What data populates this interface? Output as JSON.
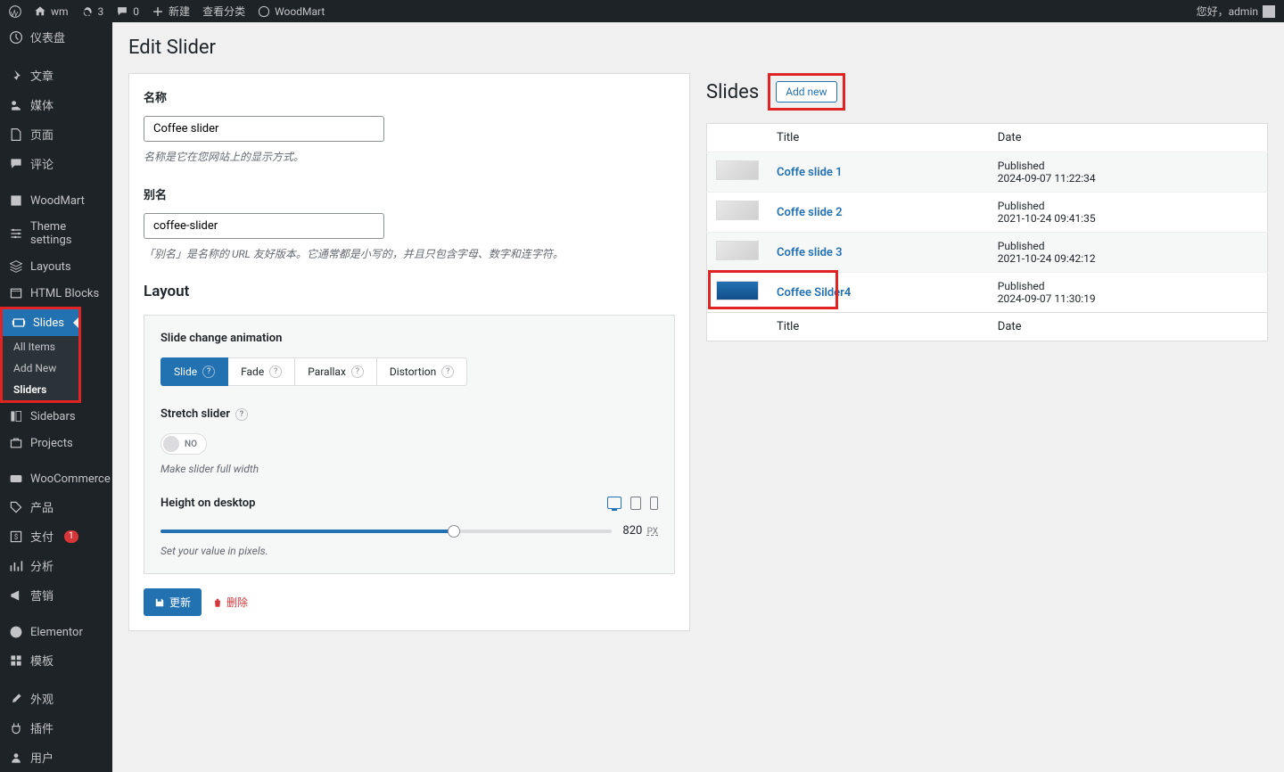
{
  "adminbar": {
    "site": "wm",
    "updates": "3",
    "comments": "0",
    "new": "新建",
    "view": "查看分类",
    "woodmart": "WoodMart",
    "howdy": "您好，admin"
  },
  "sidebar": {
    "dashboard": "仪表盘",
    "posts": "文章",
    "media": "媒体",
    "pages": "页面",
    "comments": "评论",
    "woodmart": "WoodMart",
    "theme_settings": "Theme settings",
    "layouts": "Layouts",
    "html_blocks": "HTML Blocks",
    "slides": "Slides",
    "slides_sub": {
      "all": "All Items",
      "add": "Add New",
      "sliders": "Sliders"
    },
    "sidebars": "Sidebars",
    "projects": "Projects",
    "woocommerce": "WooCommerce",
    "products": "产品",
    "payments": "支付",
    "payments_badge": "1",
    "analytics": "分析",
    "marketing": "营销",
    "elementor": "Elementor",
    "templates": "模板",
    "appearance": "外观",
    "plugins": "插件",
    "users": "用户"
  },
  "page": {
    "title": "Edit Slider",
    "name_label": "名称",
    "name_value": "Coffee slider",
    "name_help": "名称是它在您网站上的显示方式。",
    "slug_label": "别名",
    "slug_value": "coffee-slider",
    "slug_help": "「别名」是名称的 URL 友好版本。它通常都是小写的，并且只包含字母、数字和连字符。",
    "layout_title": "Layout",
    "animation_label": "Slide change animation",
    "animations": {
      "slide": "Slide",
      "fade": "Fade",
      "parallax": "Parallax",
      "distortion": "Distortion"
    },
    "stretch_label": "Stretch slider",
    "stretch_toggle": "NO",
    "stretch_help": "Make slider full width",
    "height_label": "Height on desktop",
    "height_value": "820",
    "height_unit": "PX",
    "height_help": "Set your value in pixels.",
    "update_btn": "更新",
    "delete_btn": "删除"
  },
  "slides": {
    "title": "Slides",
    "add_new": "Add new",
    "th_title": "Title",
    "th_date": "Date",
    "rows": [
      {
        "title": "Coffe slide 1",
        "status": "Published",
        "date": "2024-09-07 11:22:34"
      },
      {
        "title": "Coffe slide 2",
        "status": "Published",
        "date": "2021-10-24 09:41:35"
      },
      {
        "title": "Coffe slide 3",
        "status": "Published",
        "date": "2021-10-24 09:42:12"
      },
      {
        "title": "Coffee Silder4",
        "status": "Published",
        "date": "2024-09-07 11:30:19"
      }
    ]
  }
}
